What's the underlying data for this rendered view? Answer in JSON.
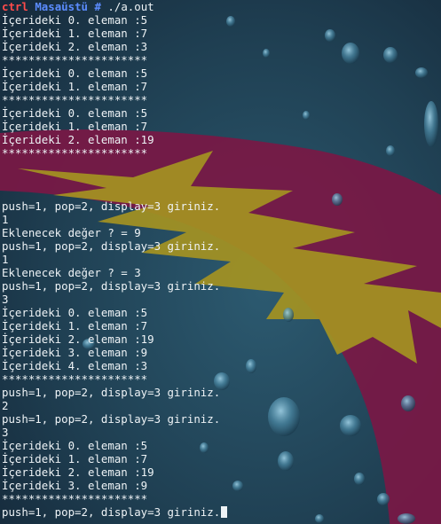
{
  "wallpaper": {
    "base_color": "#1f3d4f",
    "stripe_color": "#7a1845",
    "flame_color": "#a49322"
  },
  "prompt": {
    "user": "ctrl",
    "directory": "Masaüstü",
    "symbol": "#",
    "command": "./a.out"
  },
  "output_lines": [
    "İçerideki 0. eleman :5",
    "İçerideki 1. eleman :7",
    "İçerideki 2. eleman :3",
    "**********************",
    "İçerideki 0. eleman :5",
    "İçerideki 1. eleman :7",
    "**********************",
    "İçerideki 0. eleman :5",
    "İçerideki 1. eleman :7",
    "İçerideki 2. eleman :19",
    "**********************",
    "",
    "",
    "",
    "push=1, pop=2, display=3 giriniz.",
    "1",
    "Eklenecek değer ? = 9",
    "push=1, pop=2, display=3 giriniz.",
    "1",
    "Eklenecek değer ? = 3",
    "push=1, pop=2, display=3 giriniz.",
    "3",
    "İçerideki 0. eleman :5",
    "İçerideki 1. eleman :7",
    "İçerideki 2. eleman :19",
    "İçerideki 3. eleman :9",
    "İçerideki 4. eleman :3",
    "**********************",
    "push=1, pop=2, display=3 giriniz.",
    "2",
    "push=1, pop=2, display=3 giriniz.",
    "3",
    "İçerideki 0. eleman :5",
    "İçerideki 1. eleman :7",
    "İçerideki 2. eleman :19",
    "İçerideki 3. eleman :9",
    "**********************",
    "push=1, pop=2, display=3 giriniz."
  ]
}
